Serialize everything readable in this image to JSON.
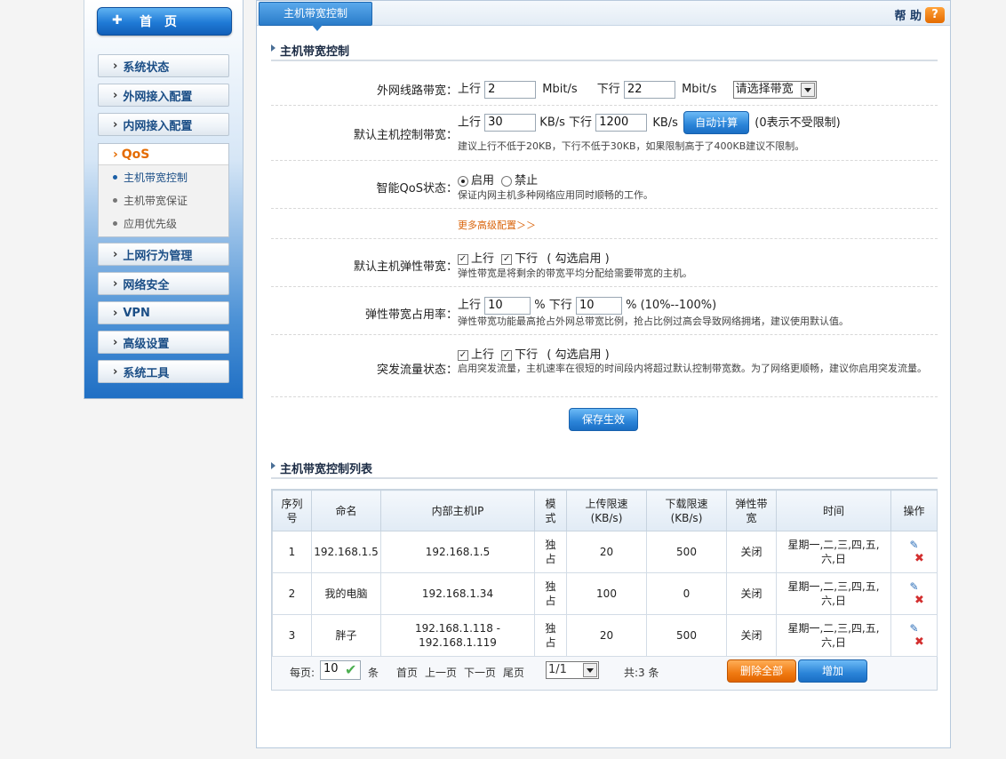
{
  "sidebar": {
    "home": "首页",
    "items": {
      "system_status": "系统状态",
      "wan_config": "外网接入配置",
      "lan_config": "内网接入配置",
      "qos": "QoS",
      "qos_sub_bw_control": "主机带宽控制",
      "qos_sub_bw_guarantee": "主机带宽保证",
      "qos_sub_app_priority": "应用优先级",
      "behavior_mgmt": "上网行为管理",
      "network_security": "网络安全",
      "vpn": "VPN",
      "advanced": "高级设置",
      "tools": "系统工具"
    }
  },
  "header": {
    "tab": "主机带宽控制",
    "help": "帮 助",
    "help_icon": "?"
  },
  "form": {
    "section_title": "主机带宽控制",
    "wan_bw": {
      "label": "外网线路带宽：",
      "up_label": "上行",
      "up_value": "2",
      "up_unit": "Mbit/s",
      "down_label": "下行",
      "down_value": "22",
      "down_unit": "Mbit/s",
      "select_value": "请选择带宽"
    },
    "default_bw": {
      "label": "默认主机控制带宽：",
      "up_label": "上行",
      "up_value": "30",
      "up_unit": "KB/s",
      "down_label": "下行",
      "down_value": "1200",
      "down_unit": "KB/s",
      "auto_button": "自动计算",
      "hint": "(0表示不受限制)",
      "note": "建议上行不低于20KB，下行不低于30KB，如果限制高于了400KB建议不限制。"
    },
    "qos_state": {
      "label": "智能QoS状态：",
      "enable": "启用",
      "disable": "禁止",
      "selected": "enable",
      "note": "保证内网主机多种网络应用同时顺畅的工作。"
    },
    "more_link": "更多高级配置＞＞",
    "elastic_bw": {
      "label": "默认主机弹性带宽：",
      "up": "上行",
      "down": "下行",
      "hint": "( 勾选启用 )",
      "up_checked": true,
      "down_checked": true,
      "note": "弹性带宽是将剩余的带宽平均分配给需要带宽的主机。"
    },
    "elastic_ratio": {
      "label": "弹性带宽占用率：",
      "up_label": "上行",
      "up_value": "10",
      "pct1": "%",
      "down_label": "下行",
      "down_value": "10",
      "pct2": "% (10%--100%)",
      "note": "弹性带宽功能最高抢占外网总带宽比例，抢占比例过高会导致网络拥堵，建议使用默认值。"
    },
    "burst": {
      "label": "突发流量状态：",
      "up": "上行",
      "down": "下行",
      "hint": "( 勾选启用 )",
      "up_checked": true,
      "down_checked": true,
      "note": "启用突发流量，主机速率在很短的时间段内将超过默认控制带宽数。为了网络更顺畅，建议你启用突发流量。"
    },
    "save_button": "保存生效"
  },
  "list": {
    "section_title": "主机带宽控制列表",
    "columns": [
      "序列号",
      "命名",
      "内部主机IP",
      "模式",
      "上传限速(KB/s)",
      "下载限速(KB/s)",
      "弹性带宽",
      "时间",
      "操作"
    ],
    "rows": [
      {
        "idx": "1",
        "name": "192.168.1.5",
        "ip": "192.168.1.5",
        "mode": "独占",
        "up": "20",
        "down": "500",
        "elastic": "关闭",
        "time": "星期一,二,三,四,五,六,日"
      },
      {
        "idx": "2",
        "name": "我的电脑",
        "ip": "192.168.1.34",
        "mode": "独占",
        "up": "100",
        "down": "0",
        "elastic": "关闭",
        "time": "星期一,二,三,四,五,六,日"
      },
      {
        "idx": "3",
        "name": "胖子",
        "ip": "192.168.1.118 - 192.168.1.119",
        "mode": "独占",
        "up": "20",
        "down": "500",
        "elastic": "关闭",
        "time": "星期一,二,三,四,五,六,日"
      }
    ],
    "pager": {
      "per_page_label": "每页:",
      "per_page_value": "10",
      "per_page_unit": "条",
      "first": "首页",
      "prev": "上一页",
      "next": "下一页",
      "last": "尾页",
      "page_value": "1/1",
      "total": "共:3 条",
      "delete_all": "删除全部",
      "add": "增加"
    }
  },
  "colors": {
    "accent_blue": "#2b84d8",
    "accent_orange": "#e46b00",
    "delete_red": "#d32f2f"
  }
}
